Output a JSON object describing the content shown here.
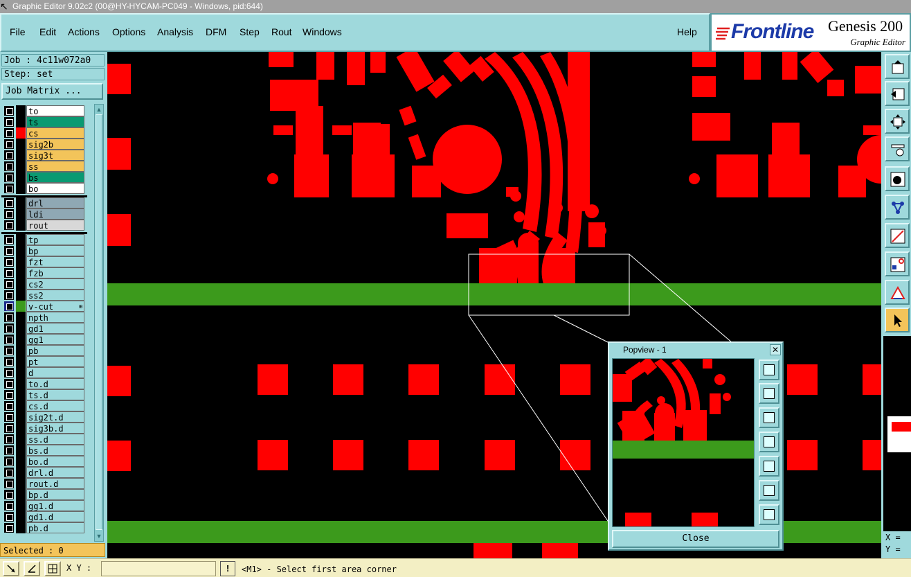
{
  "window": {
    "title": "Graphic Editor 9.02c2 (00@HY-HYCAM-PC049 - Windows, pid:644)"
  },
  "menu": [
    "File",
    "Edit",
    "Actions",
    "Options",
    "Analysis",
    "DFM",
    "Step",
    "Rout",
    "Windows"
  ],
  "help_label": "Help",
  "logo": {
    "brand": "Frontline",
    "product": "Genesis 200",
    "subtitle": "Graphic Editor"
  },
  "job": {
    "job_label": "Job : 4c11w072a0",
    "step_label": "Step: set",
    "matrix_button": "Job Matrix ..."
  },
  "layers": [
    {
      "name": "to",
      "color": "#ffffff"
    },
    {
      "name": "ts",
      "color": "#0a9a72"
    },
    {
      "name": "cs",
      "color": "#f3c45a",
      "indicator": "#ff0000"
    },
    {
      "name": "sig2b",
      "color": "#f3c45a"
    },
    {
      "name": "sig3t",
      "color": "#f3c45a"
    },
    {
      "name": "ss",
      "color": "#f3c45a"
    },
    {
      "name": "bs",
      "color": "#0a9a72"
    },
    {
      "name": "bo",
      "color": "#ffffff"
    },
    {
      "name": "drl",
      "color": "#8fa8b4"
    },
    {
      "name": "ldi",
      "color": "#8fa8b4"
    },
    {
      "name": "rout",
      "color": "#d8d8d8"
    },
    {
      "name": "tp",
      "color": "#9fd9dc"
    },
    {
      "name": "bp",
      "color": "#9fd9dc"
    },
    {
      "name": "fzt",
      "color": "#9fd9dc"
    },
    {
      "name": "fzb",
      "color": "#9fd9dc"
    },
    {
      "name": "cs2",
      "color": "#9fd9dc"
    },
    {
      "name": "ss2",
      "color": "#9fd9dc"
    },
    {
      "name": "v-cut",
      "color": "#9fd9dc",
      "indicator": "#3c9a1c",
      "selected": true
    },
    {
      "name": "npth",
      "color": "#9fd9dc"
    },
    {
      "name": "gd1",
      "color": "#9fd9dc"
    },
    {
      "name": "gg1",
      "color": "#9fd9dc"
    },
    {
      "name": "pb",
      "color": "#9fd9dc"
    },
    {
      "name": "pt",
      "color": "#9fd9dc"
    },
    {
      "name": "d",
      "color": "#9fd9dc"
    },
    {
      "name": "to.d",
      "color": "#9fd9dc"
    },
    {
      "name": "ts.d",
      "color": "#9fd9dc"
    },
    {
      "name": "cs.d",
      "color": "#9fd9dc"
    },
    {
      "name": "sig2t.d",
      "color": "#9fd9dc"
    },
    {
      "name": "sig3b.d",
      "color": "#9fd9dc"
    },
    {
      "name": "ss.d",
      "color": "#9fd9dc"
    },
    {
      "name": "bs.d",
      "color": "#9fd9dc"
    },
    {
      "name": "bo.d",
      "color": "#9fd9dc"
    },
    {
      "name": "drl.d",
      "color": "#9fd9dc"
    },
    {
      "name": "rout.d",
      "color": "#9fd9dc"
    },
    {
      "name": "bp.d",
      "color": "#9fd9dc"
    },
    {
      "name": "gg1.d",
      "color": "#9fd9dc"
    },
    {
      "name": "gd1.d",
      "color": "#9fd9dc"
    },
    {
      "name": "pb.d",
      "color": "#9fd9dc"
    }
  ],
  "selected_label": "Selected : 0",
  "popview": {
    "title": "Popview - 1",
    "close_label": "Close"
  },
  "coords": {
    "x_label": "X =",
    "y_label": "Y ="
  },
  "status": {
    "xy_label": "X Y :",
    "xy_value": "",
    "alert": "!",
    "prompt": "<M1> - Select first area corner"
  },
  "colors": {
    "copper": "#ff0000",
    "vcut": "#3c9a1c",
    "panel": "#9fd9dc",
    "canvas": "#000000"
  }
}
